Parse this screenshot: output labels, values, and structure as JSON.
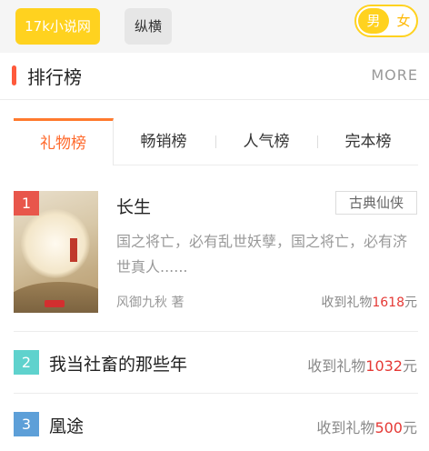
{
  "header": {
    "site_button": "17k小说网",
    "second_button": "纵横",
    "gender_toggle": {
      "male": "男",
      "female": "女",
      "selected": "男"
    }
  },
  "section": {
    "title": "排行榜",
    "more": "MORE"
  },
  "tabs": [
    {
      "label": "礼物榜",
      "active": true
    },
    {
      "label": "畅销榜",
      "active": false
    },
    {
      "label": "人气榜",
      "active": false
    },
    {
      "label": "完本榜",
      "active": false
    }
  ],
  "rankings": [
    {
      "rank": "1",
      "title": "长生",
      "genre": "古典仙侠",
      "synopsis": "国之将亡，必有乱世妖孽，国之将亡，必有济世真人......",
      "author": "风御九秋 著",
      "gift_prefix": "收到礼物",
      "gift_count": "1618",
      "gift_suffix": "元"
    },
    {
      "rank": "2",
      "title": "我当社畜的那些年",
      "gift_prefix": "收到礼物",
      "gift_count": "1032",
      "gift_suffix": "元"
    },
    {
      "rank": "3",
      "title": "凰途",
      "gift_prefix": "收到礼物",
      "gift_count": "500",
      "gift_suffix": "元"
    }
  ],
  "colors": {
    "brand_yellow": "#ffd21f",
    "accent_orange": "#ff6a2c",
    "rank1": "#e8564b",
    "rank2": "#5fd2cd",
    "rank3": "#5d9fd8",
    "gift_number": "#e53935"
  }
}
